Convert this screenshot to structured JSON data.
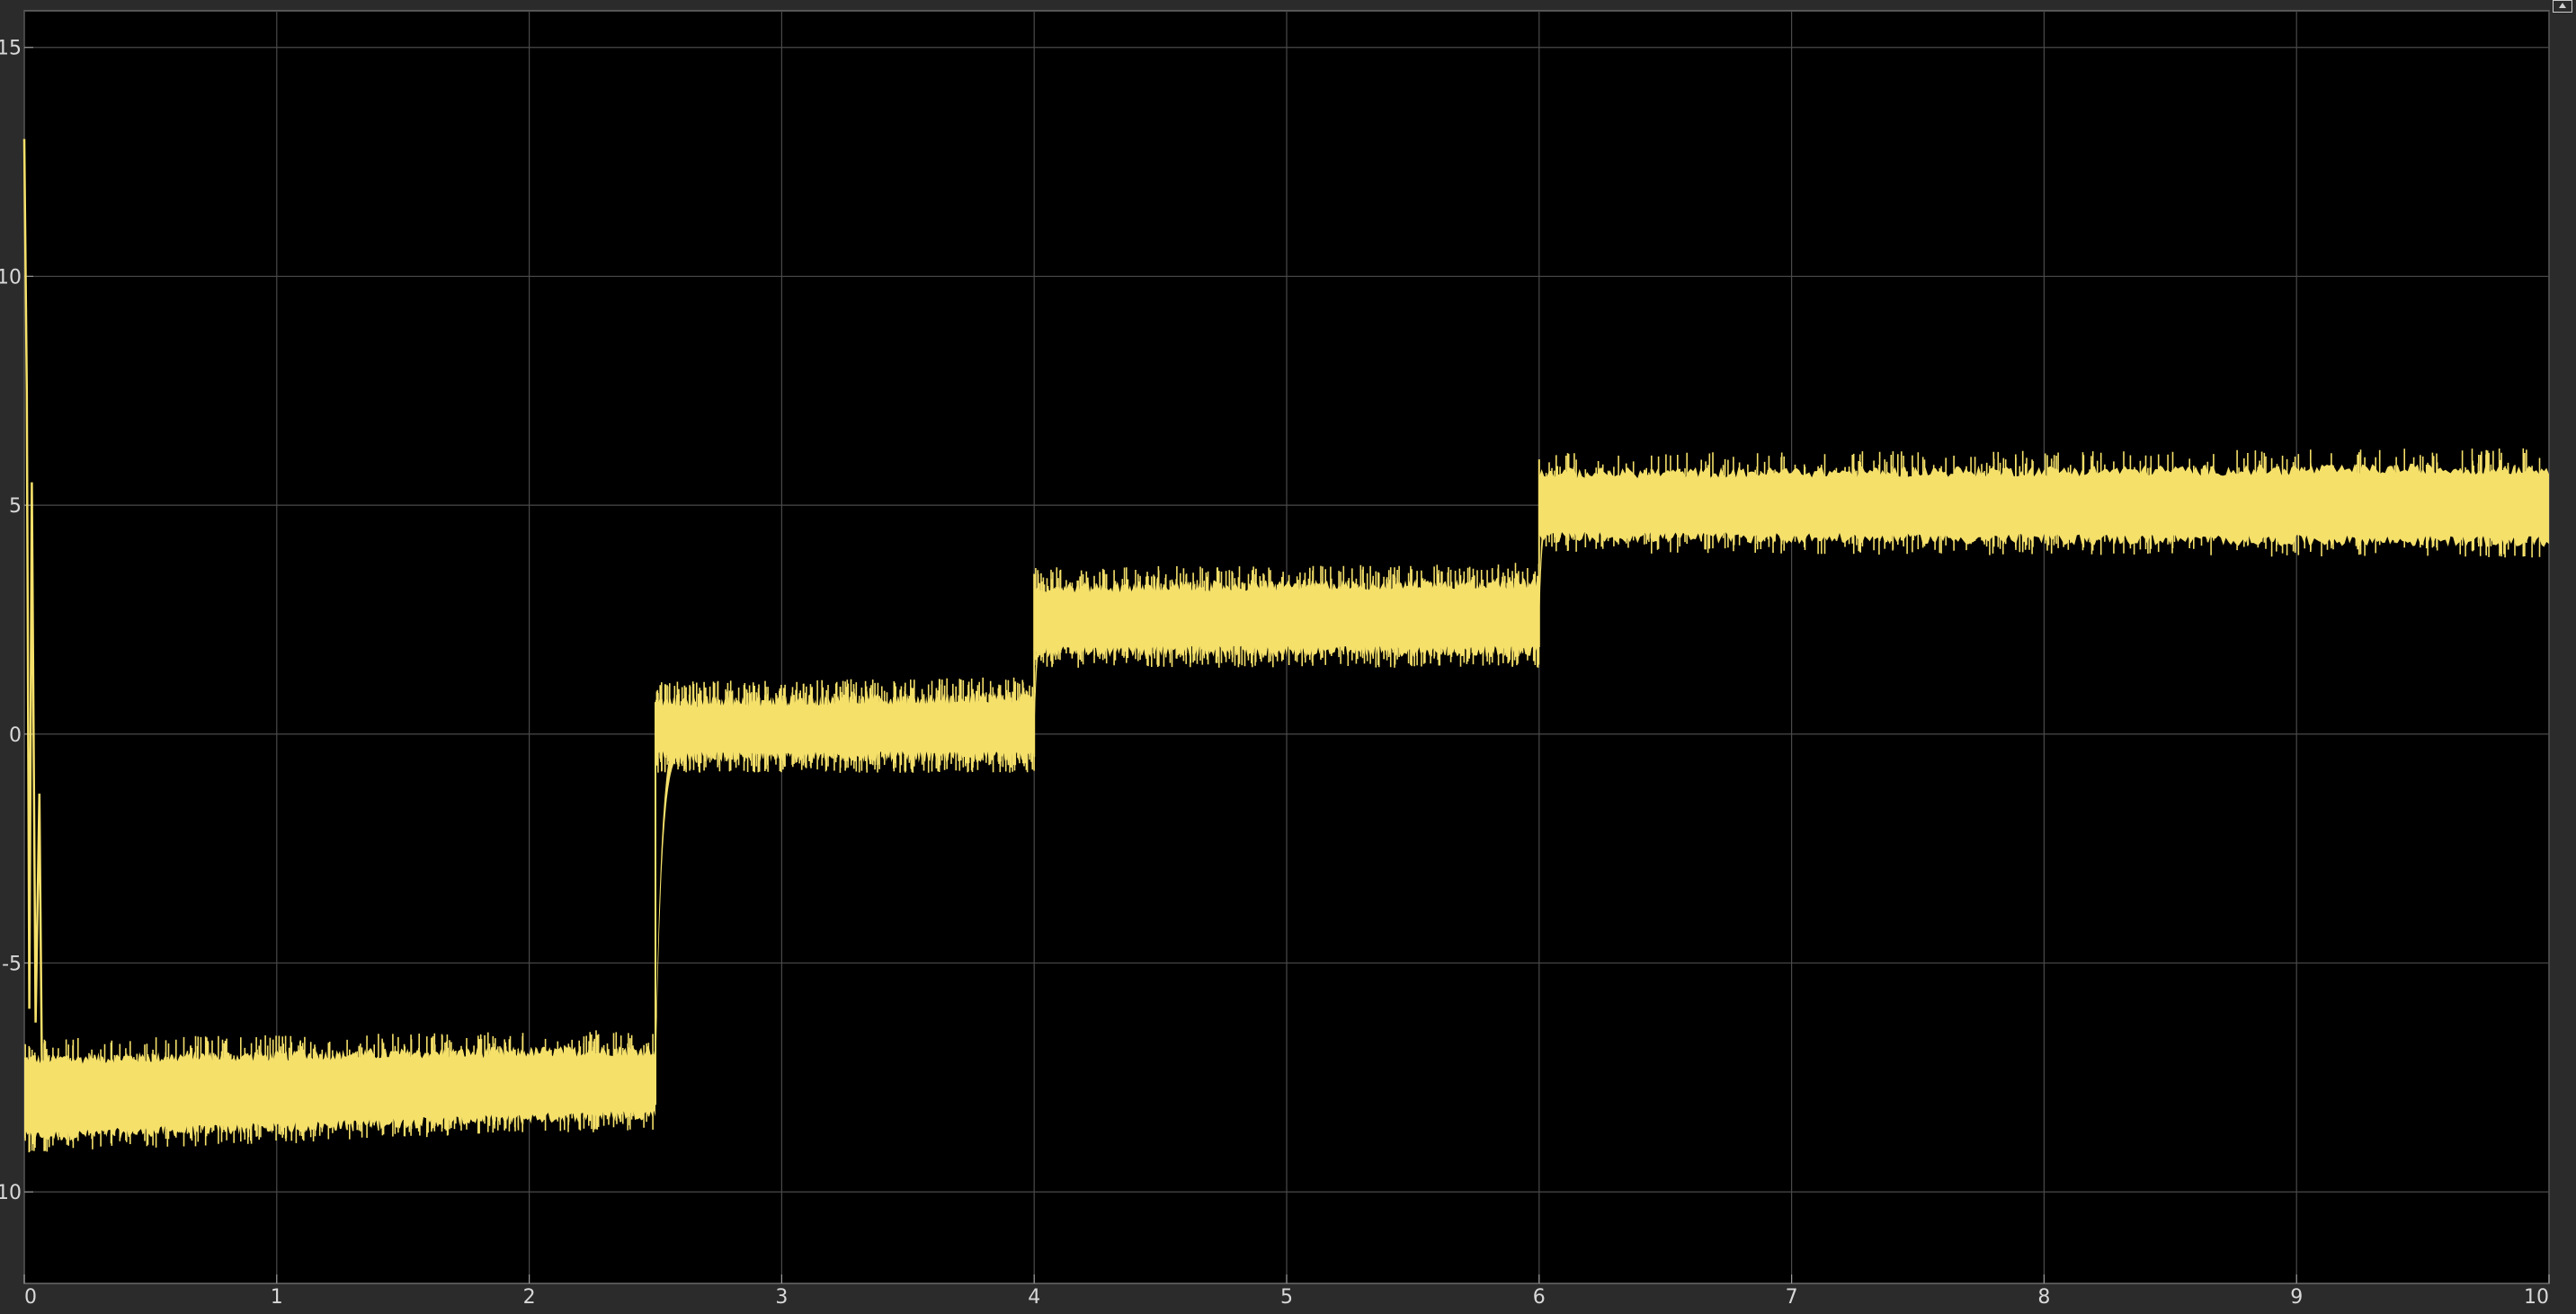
{
  "chart_data": {
    "type": "line",
    "xlim": [
      0,
      10
    ],
    "ylim": [
      -12,
      15.8
    ],
    "x_ticks": [
      0,
      1,
      2,
      3,
      4,
      5,
      6,
      7,
      8,
      9,
      10
    ],
    "y_ticks": [
      15,
      10,
      5,
      0,
      -5,
      -10
    ],
    "x_tick_labels": [
      "0",
      "1",
      "2",
      "3",
      "4",
      "5",
      "6",
      "7",
      "8",
      "9",
      "10"
    ],
    "y_tick_labels": [
      "15",
      "10",
      "5",
      "0",
      "-5",
      "-10"
    ],
    "grid": true,
    "series": [
      {
        "color": "#f5e06a",
        "segments": [
          {
            "x_start": 0.0,
            "x_end": 2.5,
            "center_start": -8.0,
            "center_end": -7.5,
            "band_low_start": -8.8,
            "band_low_end": -8.3,
            "band_high_start": -7.1,
            "band_high_end": -6.9
          },
          {
            "x_start": 2.5,
            "x_end": 4.0,
            "center_start": 0.0,
            "center_end": 0.1,
            "band_low_start": -0.5,
            "band_low_end": -0.5,
            "band_high_start": 0.7,
            "band_high_end": 0.8
          },
          {
            "x_start": 4.0,
            "x_end": 6.0,
            "center_start": 2.5,
            "center_end": 2.5,
            "band_low_start": 1.8,
            "band_low_end": 1.8,
            "band_high_start": 3.2,
            "band_high_end": 3.3
          },
          {
            "x_start": 6.0,
            "x_end": 10.0,
            "center_start": 5.0,
            "center_end": 5.0,
            "band_low_start": 4.3,
            "band_low_end": 4.2,
            "band_high_start": 5.7,
            "band_high_end": 5.8
          }
        ],
        "initial_transient": [
          {
            "x": 0.0,
            "y": 13.0
          },
          {
            "x": 0.01,
            "y": 7.5
          },
          {
            "x": 0.02,
            "y": -6.0
          },
          {
            "x": 0.03,
            "y": 5.5
          },
          {
            "x": 0.045,
            "y": -6.3
          },
          {
            "x": 0.06,
            "y": -1.3
          },
          {
            "x": 0.07,
            "y": -7.5
          },
          {
            "x": 0.09,
            "y": -8.5
          }
        ]
      }
    ]
  },
  "colors": {
    "background": "#000000",
    "grid": "#4a4a4a",
    "frame": "#6a6a6a",
    "trace": "#f5e06a"
  }
}
